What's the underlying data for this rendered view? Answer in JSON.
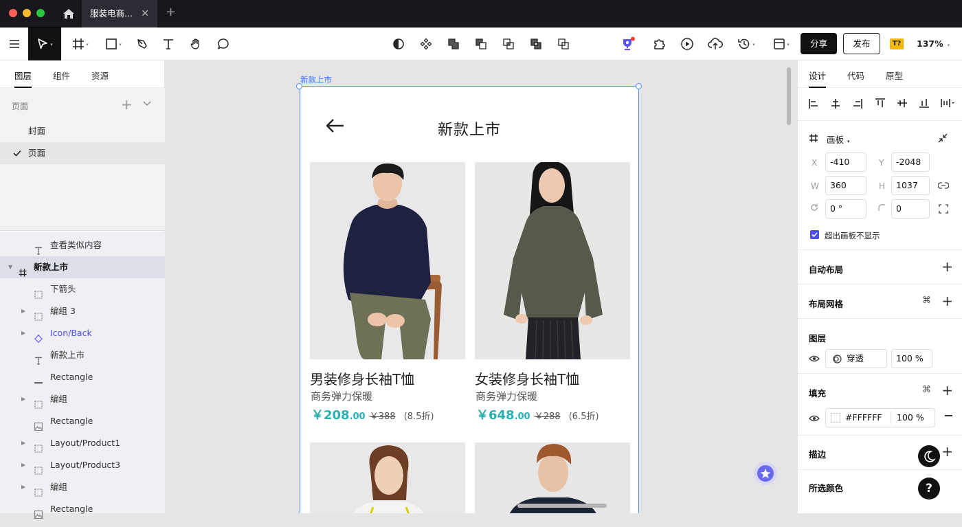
{
  "window": {
    "tab_title": "服装电商...",
    "close_glyph": "✕",
    "new_tab_glyph": "+",
    "traffic_colors": [
      "#fe5f57",
      "#febc2e",
      "#28c840"
    ]
  },
  "toolbar": {
    "share_label": "分享",
    "publish_label": "发布",
    "plugin_badge": "T?",
    "zoom": "137%"
  },
  "left_panel": {
    "tabs": [
      "图层",
      "组件",
      "资源"
    ],
    "pages_header": "页面",
    "pages": [
      {
        "label": "封面",
        "selected": false
      },
      {
        "label": "页面",
        "selected": true
      }
    ],
    "layers": [
      {
        "label": "查看类似内容",
        "icon": "text-icon",
        "indent": 1,
        "expandable": false,
        "selected": false,
        "component": false
      },
      {
        "label": "新款上市",
        "icon": "frame-icon",
        "indent": 0,
        "expandable": true,
        "selected": true,
        "component": false
      },
      {
        "label": "下箭头",
        "icon": "group-icon",
        "indent": 1,
        "expandable": false,
        "selected": false,
        "component": false
      },
      {
        "label": "编组 3",
        "icon": "group-icon",
        "indent": 1,
        "expandable": true,
        "selected": false,
        "component": false
      },
      {
        "label": "Icon/Back",
        "icon": "component-instance-icon",
        "indent": 1,
        "expandable": true,
        "selected": false,
        "component": true
      },
      {
        "label": "新款上市",
        "icon": "text-icon",
        "indent": 1,
        "expandable": false,
        "selected": false,
        "component": false
      },
      {
        "label": "Rectangle",
        "icon": "line-icon",
        "indent": 1,
        "expandable": false,
        "selected": false,
        "component": false
      },
      {
        "label": "编组",
        "icon": "group-icon",
        "indent": 1,
        "expandable": true,
        "selected": false,
        "component": false
      },
      {
        "label": "Rectangle",
        "icon": "image-icon",
        "indent": 1,
        "expandable": false,
        "selected": false,
        "component": false
      },
      {
        "label": "Layout/Product1",
        "icon": "group-icon",
        "indent": 1,
        "expandable": true,
        "selected": false,
        "component": false
      },
      {
        "label": "Layout/Product3",
        "icon": "group-icon",
        "indent": 1,
        "expandable": true,
        "selected": false,
        "component": false
      },
      {
        "label": "编组",
        "icon": "group-icon",
        "indent": 1,
        "expandable": true,
        "selected": false,
        "component": false
      },
      {
        "label": "Rectangle",
        "icon": "image-icon",
        "indent": 1,
        "expandable": false,
        "selected": false,
        "component": false
      }
    ]
  },
  "canvas": {
    "frame_label": "新款上市",
    "artboard": {
      "title": "新款上市",
      "products": [
        {
          "name": "男装修身长袖T恤",
          "subtitle": "商务弹力保暖",
          "price_int": "￥208",
          "price_dec": ".00",
          "old_price": "￥388",
          "discount": "(8.5折)"
        },
        {
          "name": "女装修身长袖T恤",
          "subtitle": "商务弹力保暖",
          "price_int": "￥648",
          "price_dec": ".00",
          "old_price": "￥288",
          "discount": "(6.5折)"
        }
      ]
    }
  },
  "right_panel": {
    "tabs": [
      "设计",
      "代码",
      "原型"
    ],
    "frame_type": "画板",
    "x_label": "X",
    "x": "-410",
    "y_label": "Y",
    "y": "-2048",
    "w_label": "W",
    "w": "360",
    "h_label": "H",
    "h": "1037",
    "rotation": "0 °",
    "radius": "0",
    "clip_label": "超出画板不显示",
    "clip_checked": true,
    "auto_layout": "自动布局",
    "layout_grid": "布局网格",
    "layer_section": "图层",
    "blend_mode": "穿透",
    "layer_opacity": "100 %",
    "fill_section": "填充",
    "fill_hex": "#FFFFFF",
    "fill_opacity": "100 %",
    "stroke_section": "描边",
    "selected_colors": "所选颜色",
    "help_glyph": "?"
  },
  "colors": {
    "accent_blue": "#3b7bff",
    "price_teal": "#28b1b0",
    "dark": "#111111",
    "fab_purple": "#6a6af0"
  }
}
